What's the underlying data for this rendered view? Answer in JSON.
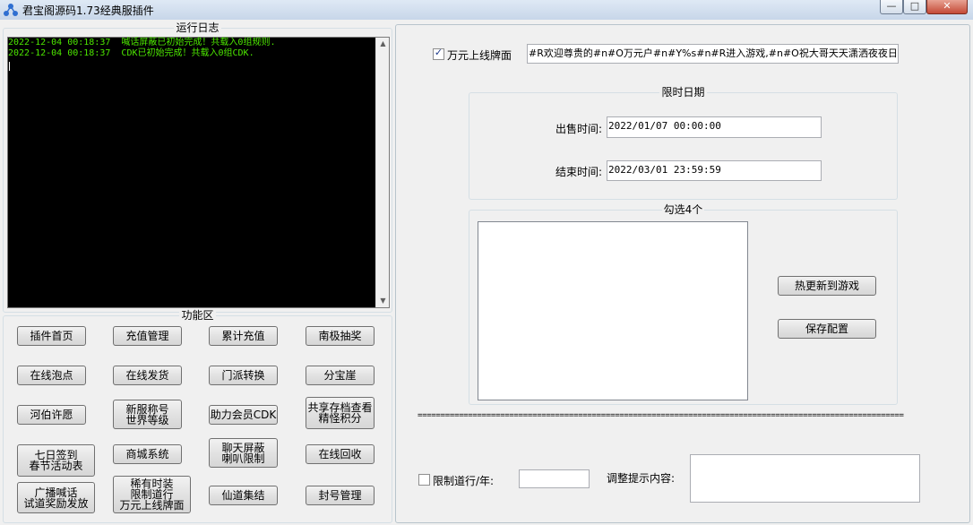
{
  "window": {
    "title": "君宝阁源码1.73经典服插件",
    "minimize_glyph": "—",
    "maximize_glyph": "□",
    "close_glyph": "✕"
  },
  "log_panel": {
    "title": "运行日志",
    "lines": [
      "2022-12-04 00:18:37  喊话屏蔽已初始完成！共载入0组规则.",
      "2022-12-04 00:18:37  CDK已初始完成！共载入0组CDK."
    ],
    "scroll_up": "▲",
    "scroll_down": "▼"
  },
  "function_panel": {
    "title": "功能区",
    "buttons": {
      "b1": [
        "插件首页"
      ],
      "b2": [
        "充值管理"
      ],
      "b3": [
        "累计充值"
      ],
      "b4": [
        "南极抽奖"
      ],
      "b5": [
        "在线泡点"
      ],
      "b6": [
        "在线发货"
      ],
      "b7": [
        "门派转换"
      ],
      "b8": [
        "分宝崖"
      ],
      "b9": [
        "河伯许愿"
      ],
      "b10": [
        "新服称号",
        "世界等级"
      ],
      "b11": [
        "助力会员CDK"
      ],
      "b12": [
        "共享存档查看",
        "精怪积分"
      ],
      "b13": [
        "七日签到",
        "春节活动表"
      ],
      "b14": [
        "商城系统"
      ],
      "b15": [
        "聊天屏蔽",
        "喇叭限制"
      ],
      "b16": [
        "在线回收"
      ],
      "b17": [
        "广播喊话",
        "试道奖励发放"
      ],
      "b18": [
        "稀有时装",
        "限制道行",
        "万元上线牌面"
      ],
      "b19": [
        "仙道集结"
      ],
      "b20": [
        "封号管理"
      ]
    }
  },
  "right_panel": {
    "checkbox_label": "万元上线牌面",
    "checkbox_checked": "✓",
    "message_value": "#R欢迎尊贵的#n#O万元户#n#Y%s#n#R进入游戏,#n#O祝大哥天天潇洒夜夜日逼!",
    "date_group": {
      "title": "限时日期",
      "start_label": "出售时间:",
      "start_value": "2022/01/07 00:00:00",
      "end_label": "结束时间:",
      "end_value": "2022/03/01 23:59:59"
    },
    "select_group": {
      "title": "勾选4个",
      "hot_update_button": "热更新到游戏",
      "save_button": "保存配置"
    },
    "separator": "==========================================================================================================",
    "limit_checkbox_label": "限制道行/年:",
    "limit_value": "",
    "hint_label": "调整提示内容:",
    "hint_value": ""
  }
}
